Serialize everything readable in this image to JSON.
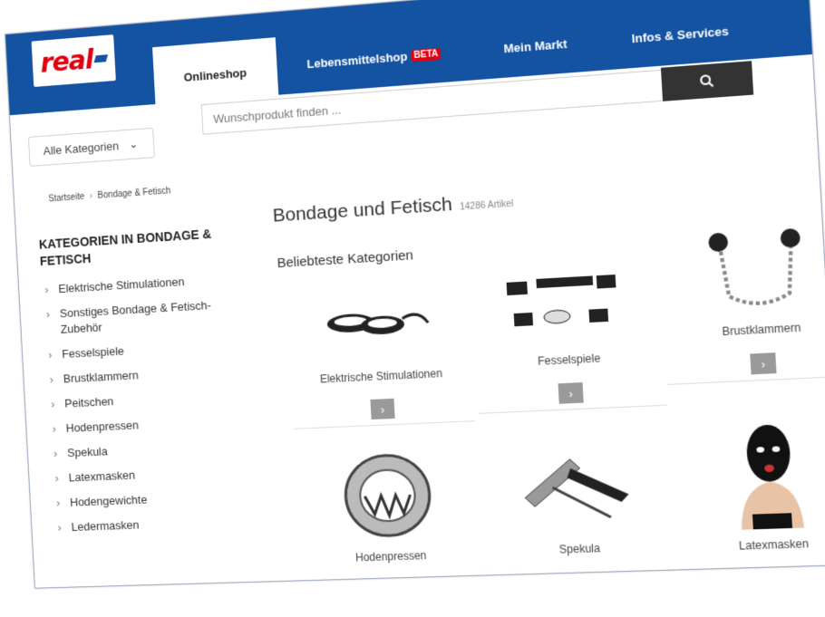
{
  "logo": {
    "text": "real"
  },
  "nav": {
    "tabs": [
      {
        "label": "Onlineshop",
        "active": true
      },
      {
        "label": "Lebensmittelshop",
        "badge": "BETA"
      },
      {
        "label": "Mein Markt"
      },
      {
        "label": "Infos & Services"
      }
    ]
  },
  "category_select": {
    "value": "Alle Kategorien"
  },
  "search": {
    "placeholder": "Wunschprodukt finden ...",
    "icon": "search-icon"
  },
  "breadcrumb": {
    "home": "Startseite",
    "current": "Bondage & Fetisch"
  },
  "sidebar": {
    "title": "KATEGORIEN IN BONDAGE & FETISCH",
    "items": [
      "Elektrische Stimulationen",
      "Sonstiges Bondage & Fetisch-Zubehör",
      "Fesselspiele",
      "Brustklammern",
      "Peitschen",
      "Hodenpressen",
      "Spekula",
      "Latexmasken",
      "Hodengewichte",
      "Ledermasken"
    ]
  },
  "main": {
    "title": "Bondage und Fetisch",
    "count": "14286 Artikel",
    "section_title": "Beliebteste Kategorien",
    "tiles": [
      {
        "label": "Elektrische Stimulationen"
      },
      {
        "label": "Fesselspiele"
      },
      {
        "label": "Brustklammern"
      },
      {
        "label": "Hodenpressen"
      },
      {
        "label": "Spekula"
      },
      {
        "label": "Latexmasken"
      }
    ]
  },
  "colors": {
    "brand_blue": "#1453a2",
    "brand_red": "#e1000f"
  }
}
